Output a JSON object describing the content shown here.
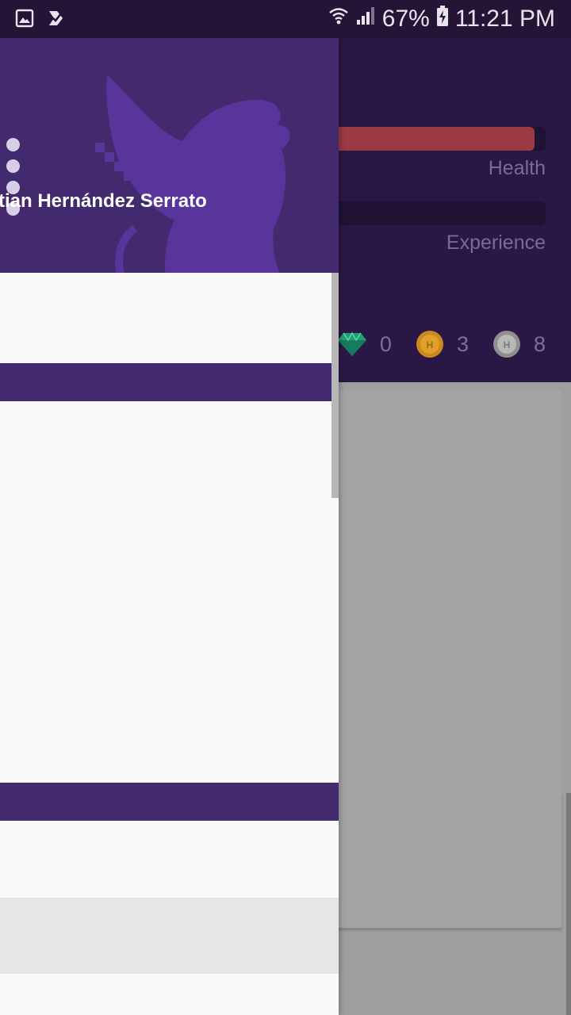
{
  "status_bar": {
    "battery": "67%",
    "time": "11:21 PM",
    "icons": [
      "gallery-icon",
      "checklist-icon",
      "wifi-icon",
      "signal-icon",
      "battery-charging-icon"
    ]
  },
  "stats": {
    "health_label": "Health",
    "health_fill": 0.95,
    "experience_label": "Experience",
    "experience_fill": 0.0
  },
  "currencies": {
    "gems": "0",
    "gold": "3",
    "hourglass": "8"
  },
  "drawer": {
    "user_name": "tian Hernández Serrato"
  },
  "colors": {
    "header_purple": "#432a6e",
    "app_header": "#2b1745",
    "health_red": "#9a3a42",
    "gem_green": "#1e9f78",
    "gold": "#e0a02a"
  }
}
